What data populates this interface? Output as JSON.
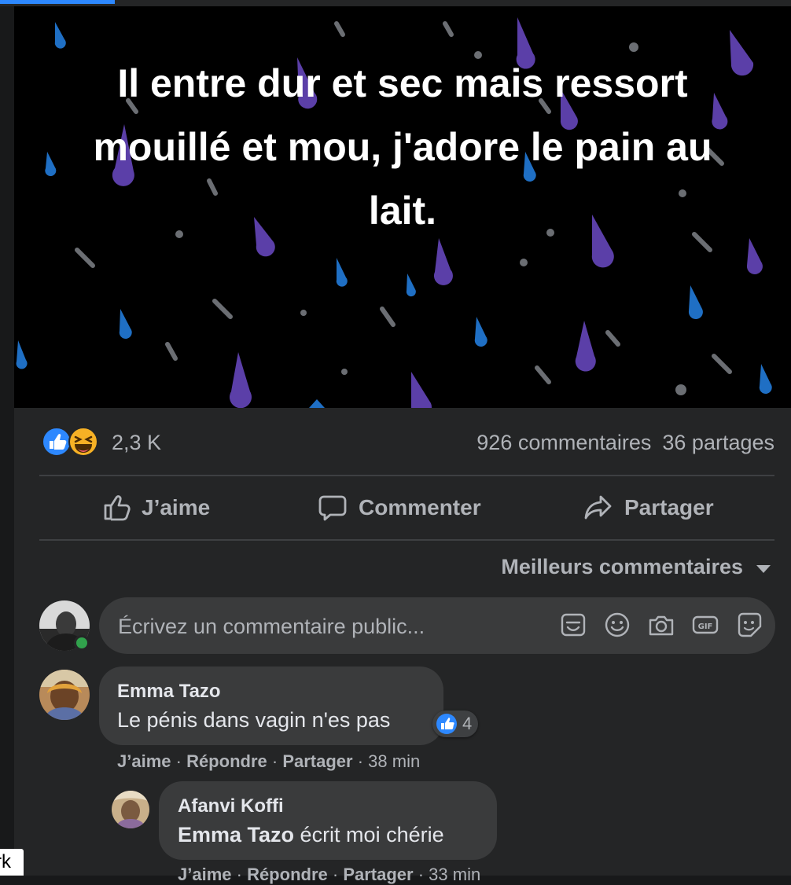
{
  "post": {
    "text": "Il entre dur et sec mais ressort mouillé et mou, j'adore le pain au lait."
  },
  "stats": {
    "reactions": "2,3 K",
    "comments": "926 commentaires",
    "shares": "36 partages"
  },
  "actions": {
    "like": "J’aime",
    "comment": "Commenter",
    "share": "Partager"
  },
  "sort": {
    "label": "Meilleurs commentaires"
  },
  "composer": {
    "placeholder": "Écrivez un commentaire public...",
    "icons": [
      "sticker-icon",
      "emoji-icon",
      "camera-icon",
      "gif-icon",
      "avatar-sticker-icon"
    ]
  },
  "comments": [
    {
      "author": "Emma Tazo",
      "text": "Le pénis dans vagin n'es pas",
      "reaction_count": "4",
      "like": "J’aime",
      "reply": "Répondre",
      "share": "Partager",
      "time": "38 min",
      "replies": [
        {
          "author": "Afanvi Koffi",
          "mention": "Emma Tazo",
          "text": " écrit moi chérie",
          "like": "J’aime",
          "reply": "Répondre",
          "share": "Partager",
          "time": "33 min"
        }
      ]
    }
  ],
  "corner_tab": "rk",
  "colors": {
    "background": "#18191a",
    "card": "#242526",
    "bubble": "#3a3b3c",
    "secondary_text": "#b0b3b8",
    "primary_text": "#e4e6eb",
    "like_blue": "#2d88ff",
    "online_green": "#31a24c",
    "rain_purple": "#5b3fa8",
    "rain_blue": "#1f6fc4"
  }
}
